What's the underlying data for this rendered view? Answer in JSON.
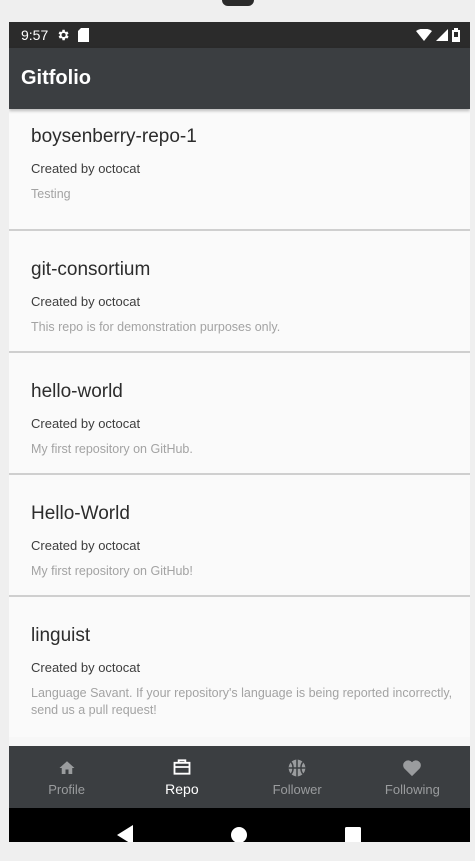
{
  "status_bar": {
    "time": "9:57"
  },
  "app_bar": {
    "title": "Gitfolio"
  },
  "repos": [
    {
      "name": "boysenberry-repo-1",
      "owner": "Created by octocat",
      "description": "Testing"
    },
    {
      "name": "git-consortium",
      "owner": "Created by octocat",
      "description": "This repo is for demonstration purposes only."
    },
    {
      "name": "hello-world",
      "owner": "Created by octocat",
      "description": "My first repository on GitHub."
    },
    {
      "name": "Hello-World",
      "owner": "Created by octocat",
      "description": "My first repository on GitHub!"
    },
    {
      "name": "linguist",
      "owner": "Created by octocat",
      "description": "Language Savant. If your repository's language is being reported incorrectly, send us a pull request!"
    }
  ],
  "bottom_nav": {
    "items": [
      {
        "label": "Profile",
        "icon": "home-icon"
      },
      {
        "label": "Repo",
        "icon": "briefcase-icon",
        "active": true
      },
      {
        "label": "Follower",
        "icon": "basketball-icon"
      },
      {
        "label": "Following",
        "icon": "heart-icon"
      }
    ]
  },
  "system_nav": {
    "icons": [
      "back-icon",
      "home-circle-icon",
      "recents-icon"
    ]
  },
  "colors": {
    "status_bar": "#2b2b2b",
    "app_bar": "#3b3e41",
    "nav_active": "#ffffff",
    "nav_inactive": "#9a9c9e"
  }
}
